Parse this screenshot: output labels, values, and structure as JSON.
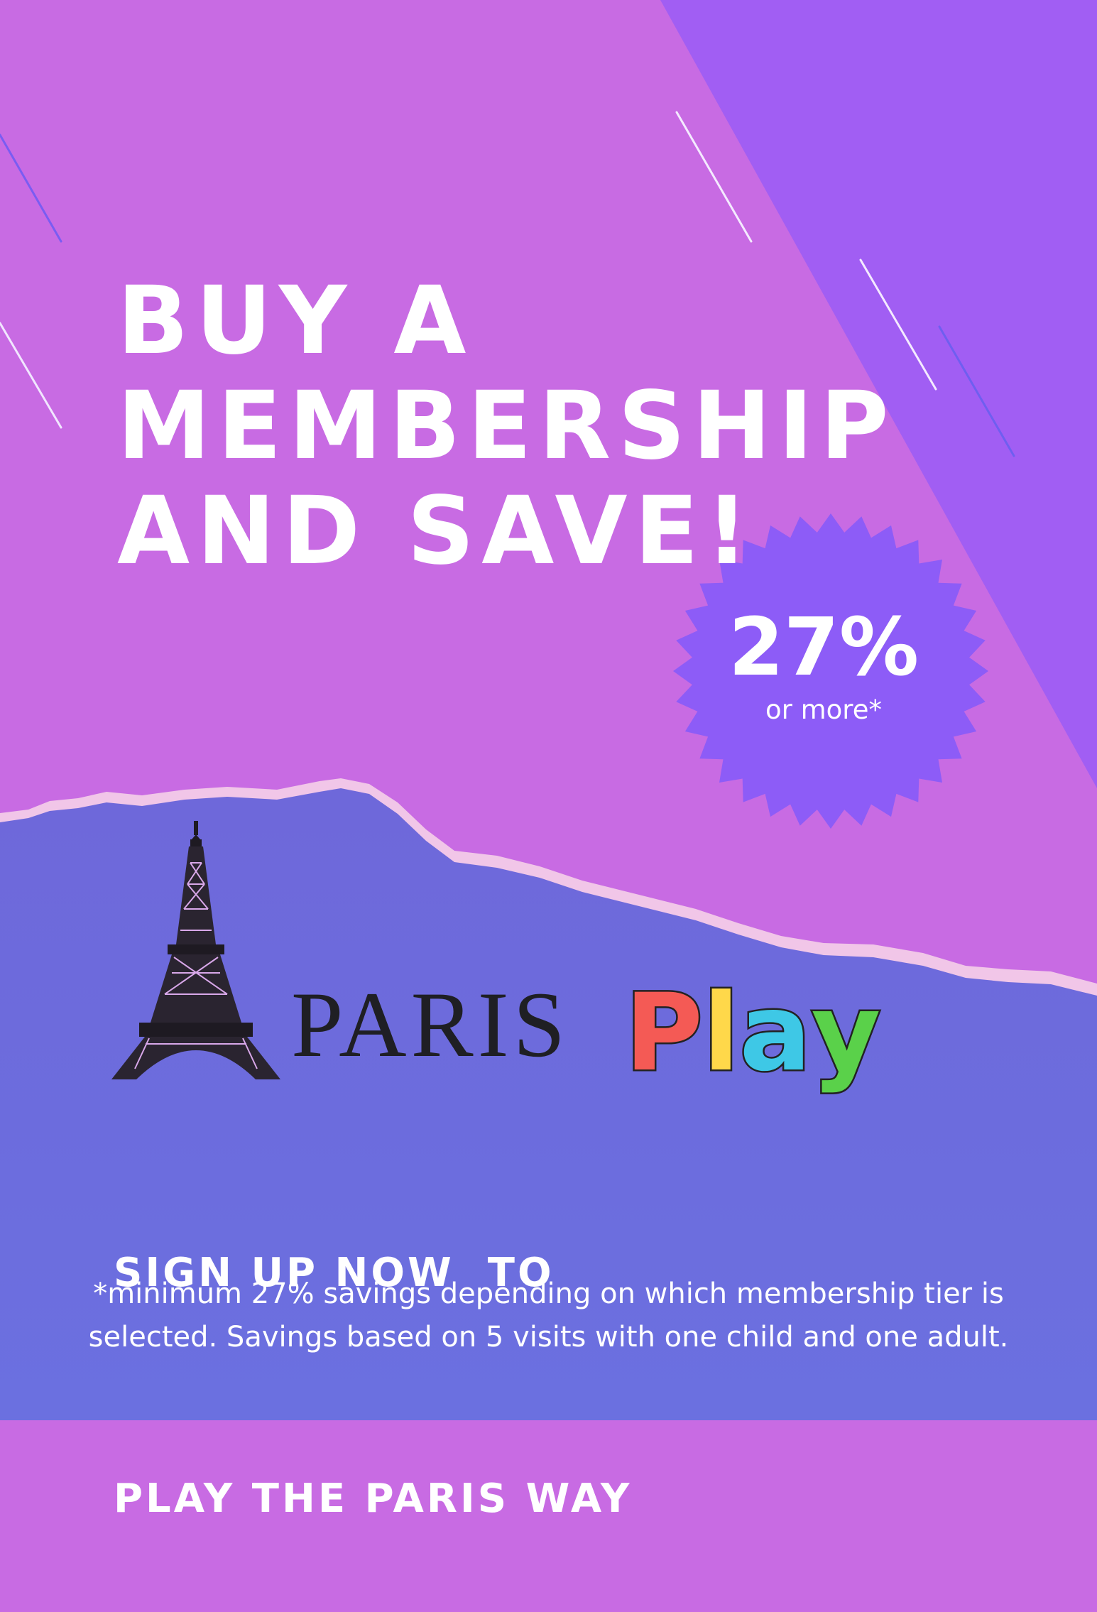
{
  "headline": {
    "line1": "Buy a",
    "line2": "membership",
    "line3": "and save!"
  },
  "badge": {
    "percent": "27%",
    "subtext": "or more*"
  },
  "logo": {
    "word1": "PARIS",
    "word2_letters": [
      "P",
      "l",
      "a",
      "y"
    ],
    "word2_colors": [
      "#f45a55",
      "#ffd84a",
      "#3ec8e6",
      "#5ad14a"
    ],
    "tower_icon": "eiffel-tower-icon"
  },
  "cta": {
    "line1": "Sign up now  to",
    "line2": "play the Paris way"
  },
  "disclaimer": "*minimum 27% savings depending on which membership tier is selected. Savings based on 5 visits with one child and one adult.",
  "colors": {
    "top_background": "#c86be3",
    "corner_background": "#a15ef3",
    "bottom_background": "#6b6bdc",
    "badge": "#8d5cf7",
    "paper_edge": "#f1c6e8"
  }
}
